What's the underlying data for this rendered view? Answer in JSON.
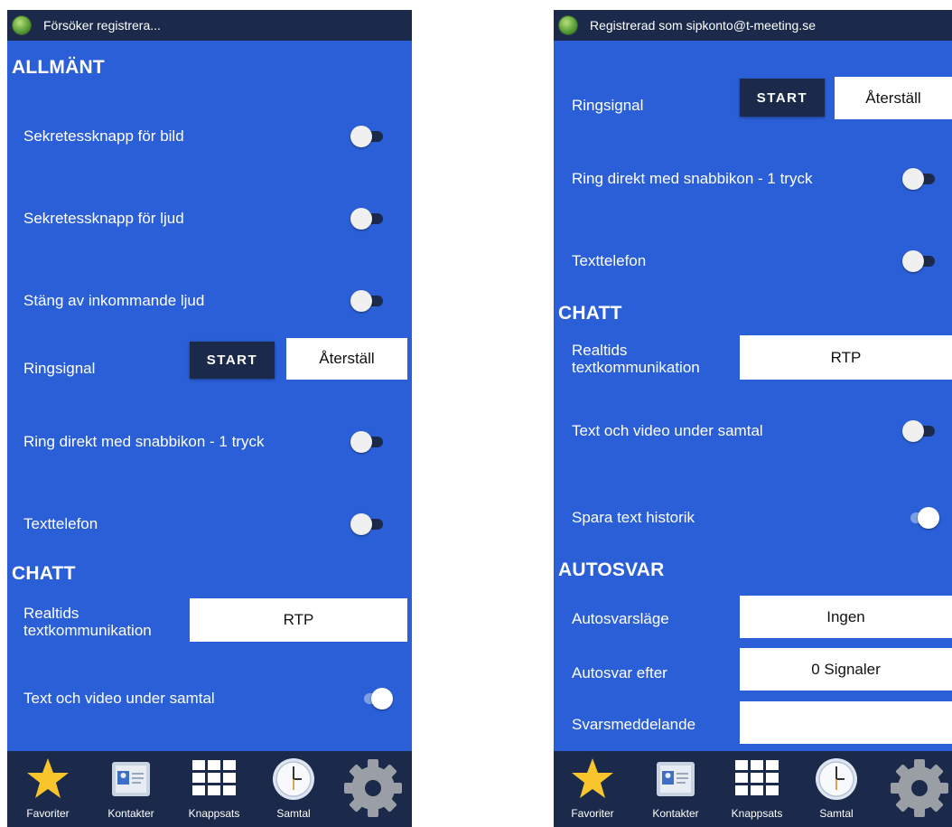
{
  "left": {
    "status_text": "Försöker registrera...",
    "sections": {
      "allmant": "ALLMÄNT",
      "chatt": "CHATT"
    },
    "rows": {
      "privacy_video": "Sekretessknapp för bild",
      "privacy_audio": "Sekretessknapp för ljud",
      "mute_incoming": "Stäng av inkommande ljud",
      "ringtone": "Ringsignal",
      "quick_dial": "Ring direkt med snabbikon - 1 tryck",
      "text_phone": "Texttelefon",
      "rtt": "Realtids textkommunikation",
      "text_video": "Text och video under samtal"
    },
    "toggles": {
      "privacy_video": false,
      "privacy_audio": false,
      "mute_incoming": false,
      "quick_dial": false,
      "text_phone": false,
      "text_video": true
    },
    "ringtone_start": "START",
    "ringtone_reset": "Återställ",
    "rtt_value": "RTP"
  },
  "right": {
    "status_text": "Registrerad som sipkonto@t-meeting.se",
    "sections": {
      "chatt": "CHATT",
      "autosvar": "AUTOSVAR"
    },
    "rows": {
      "ringtone": "Ringsignal",
      "quick_dial": "Ring direkt med snabbikon - 1 tryck",
      "text_phone": "Texttelefon",
      "rtt": "Realtids textkommunikation",
      "text_video": "Text och video under samtal",
      "save_history": "Spara text historik",
      "autoanswer_mode": "Autosvarsläge",
      "autoanswer_after": "Autosvar efter",
      "reply_message": "Svarsmeddelande"
    },
    "toggles": {
      "quick_dial": false,
      "text_phone": false,
      "text_video": false,
      "save_history": true
    },
    "ringtone_start": "START",
    "ringtone_reset": "Återställ",
    "rtt_value": "RTP",
    "autoanswer_mode_value": "Ingen",
    "autoanswer_after_value": "0 Signaler",
    "reply_message_value": ""
  },
  "nav": {
    "favorites": "Favoriter",
    "contacts": "Kontakter",
    "keypad": "Knappsats",
    "calls": "Samtal",
    "settings": ""
  },
  "colors": {
    "background": "#2b5fd7",
    "bars": "#1b2a4a",
    "star": "#f8c62c"
  }
}
